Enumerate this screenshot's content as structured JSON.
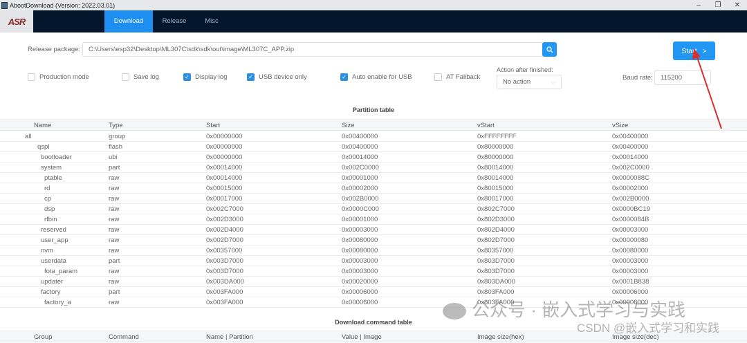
{
  "window": {
    "title": "AbootDownload (Version: 2022.03.01)",
    "minimize": "–",
    "restore": "❐",
    "close": "✕"
  },
  "nav": {
    "logo": "ASR",
    "tabs": [
      {
        "label": "Download",
        "active": true
      },
      {
        "label": "Release"
      },
      {
        "label": "Misc"
      }
    ]
  },
  "release": {
    "label": "Release package:",
    "value": "C:\\Users\\esp32\\Desktop\\ML307C\\sdk\\sdk\\out\\image\\ML307C_APP.zip",
    "search_icon": "search-icon"
  },
  "start_button": {
    "label": "Start",
    "icon": ">"
  },
  "options": [
    {
      "label": "Production mode",
      "checked": false
    },
    {
      "label": "Save log",
      "checked": false
    },
    {
      "label": "Display log",
      "checked": true
    },
    {
      "label": "USB device only",
      "checked": true
    },
    {
      "label": "Auto enable for USB",
      "checked": true
    },
    {
      "label": "AT Fallback",
      "checked": false
    }
  ],
  "action": {
    "label": "Action after finished:",
    "value": "No action"
  },
  "baud": {
    "label": "Baud rate:",
    "value": "115200"
  },
  "partition_table": {
    "title": "Partition table",
    "columns": [
      "Name",
      "Type",
      "Start",
      "Size",
      "vStart",
      "vSize"
    ],
    "rows": [
      {
        "level": 0,
        "cells": [
          "all",
          "group",
          "0x00000000",
          "0x00400000",
          "0xFFFFFFFF",
          "0x00400000"
        ]
      },
      {
        "level": 1,
        "cells": [
          "qspl",
          "flash",
          "0x00000000",
          "0x00400000",
          "0x80000000",
          "0x00400000"
        ]
      },
      {
        "level": 2,
        "cells": [
          "bootloader",
          "ubi",
          "0x00000000",
          "0x00014000",
          "0x80000000",
          "0x00014000"
        ]
      },
      {
        "level": 2,
        "cells": [
          "system",
          "part",
          "0x00014000",
          "0x002C0000",
          "0x80014000",
          "0x002C0000"
        ]
      },
      {
        "level": 3,
        "cells": [
          "ptable",
          "raw",
          "0x00014000",
          "0x00001000",
          "0x80014000",
          "0x0000088C"
        ]
      },
      {
        "level": 3,
        "cells": [
          "rd",
          "raw",
          "0x00015000",
          "0x00002000",
          "0x80015000",
          "0x00002000"
        ]
      },
      {
        "level": 3,
        "cells": [
          "cp",
          "raw",
          "0x00017000",
          "0x002B0000",
          "0x80017000",
          "0x002B0000"
        ]
      },
      {
        "level": 3,
        "cells": [
          "dsp",
          "raw",
          "0x002C7000",
          "0x0000C000",
          "0x802C7000",
          "0x0000BC19"
        ]
      },
      {
        "level": 3,
        "cells": [
          "rfbin",
          "raw",
          "0x002D3000",
          "0x00001000",
          "0x802D3000",
          "0x0000084B"
        ]
      },
      {
        "level": 2,
        "cells": [
          "reserved",
          "raw",
          "0x002D4000",
          "0x00003000",
          "0x802D4000",
          "0x00003000"
        ]
      },
      {
        "level": 2,
        "cells": [
          "user_app",
          "raw",
          "0x002D7000",
          "0x00080000",
          "0x802D7000",
          "0x00000080"
        ]
      },
      {
        "level": 2,
        "cells": [
          "nvm",
          "raw",
          "0x00357000",
          "0x00080000",
          "0x80357000",
          "0x00080000"
        ]
      },
      {
        "level": 2,
        "cells": [
          "userdata",
          "part",
          "0x003D7000",
          "0x00003000",
          "0x803D7000",
          "0x00003000"
        ]
      },
      {
        "level": 3,
        "cells": [
          "fota_param",
          "raw",
          "0x003D7000",
          "0x00003000",
          "0x803D7000",
          "0x00003000"
        ]
      },
      {
        "level": 2,
        "cells": [
          "updater",
          "raw",
          "0x003DA000",
          "0x00020000",
          "0x803DA000",
          "0x0001B838"
        ]
      },
      {
        "level": 2,
        "cells": [
          "factory",
          "part",
          "0x003FA000",
          "0x00006000",
          "0x803FA000",
          "0x00006000"
        ]
      },
      {
        "level": 3,
        "cells": [
          "factory_a",
          "raw",
          "0x003FA000",
          "0x00006000",
          "0x803FA000",
          "0x00006000"
        ]
      }
    ]
  },
  "command_table": {
    "title": "Download command table",
    "columns": [
      "Group",
      "Command",
      "Name | Partition",
      "Value | Image",
      "Image size(hex)",
      "Image size(dec)"
    ]
  },
  "watermark": {
    "line1": "公众号 · 嵌入式学习与实践",
    "line2": "CSDN @嵌入式学习和实践"
  },
  "colors": {
    "accent": "#1f8ef1",
    "nav_bg": "#03162b",
    "arrow": "#d9302c"
  }
}
